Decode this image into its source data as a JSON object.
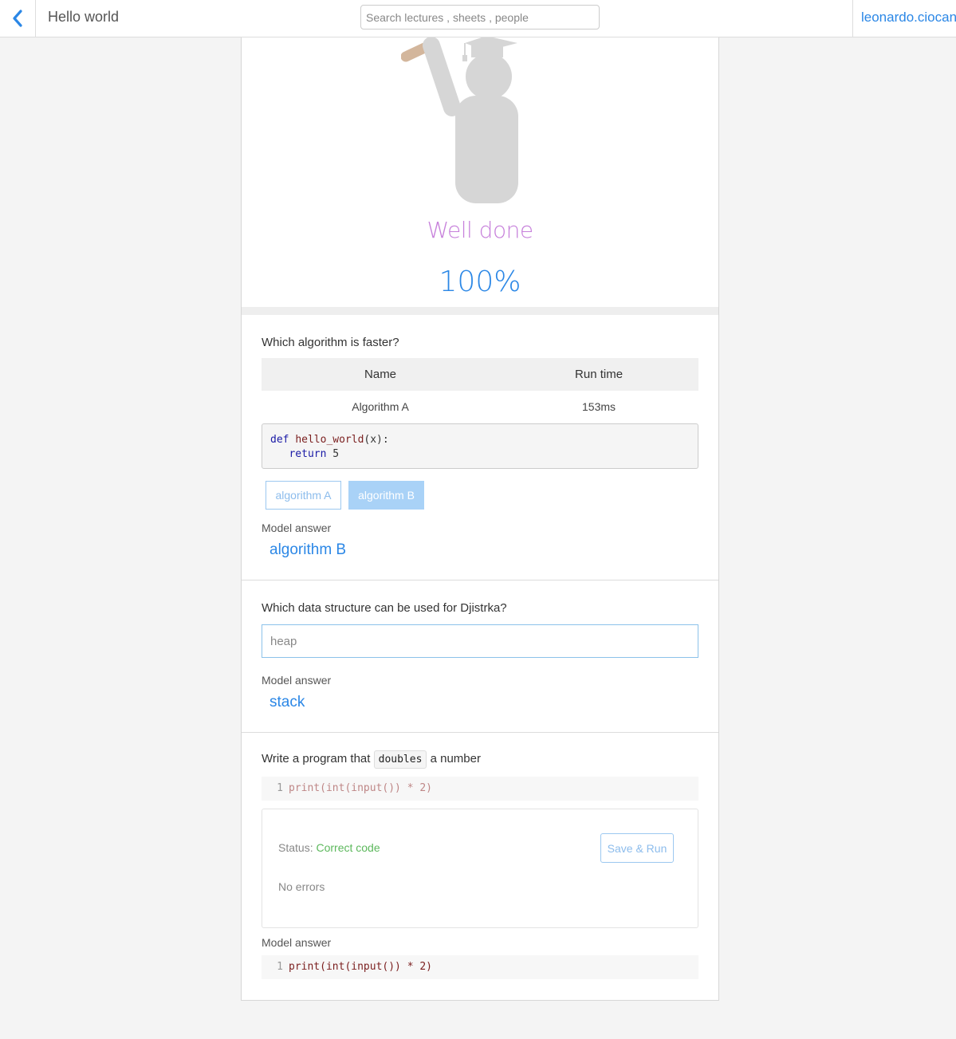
{
  "header": {
    "title": "Hello world",
    "search_placeholder": "Search lectures , sheets , people",
    "user": "leonardo.ciocan"
  },
  "result": {
    "message": "Well done",
    "score": "100%"
  },
  "question1": {
    "prompt": "Which algorithm is faster?",
    "table": {
      "headers": [
        "Name",
        "Run time"
      ],
      "rows": [
        [
          "Algorithm A",
          "153ms"
        ]
      ]
    },
    "code": {
      "line1_kw": "def",
      "line1_fn": "hello_world",
      "line1_rest": "(x):",
      "line2_kw": "return",
      "line2_rest": " 5"
    },
    "options": [
      "algorithm A",
      "algorithm B"
    ],
    "selected": "algorithm B",
    "model_label": "Model answer",
    "model_answer": "algorithm B"
  },
  "question2": {
    "prompt": "Which data structure can be used for Djistrka?",
    "input_value": "heap",
    "model_label": "Model answer",
    "model_answer": "stack"
  },
  "question3": {
    "prompt_before": "Write a program that",
    "prompt_code": "doubles",
    "prompt_after": "a number",
    "editor_line_number": "1",
    "editor_code": "print(int(input()) * 2)",
    "status_label": "Status:",
    "status_value": "Correct code",
    "errors_text": "No errors",
    "save_run_label": "Save & Run",
    "model_label": "Model answer",
    "model_line_number": "1",
    "model_code": "print(int(input()) * 2)"
  },
  "colors": {
    "accent": "#2b87e6",
    "well_done": "#c781db",
    "success": "#5cb85c"
  },
  "icons": {
    "back": "chevron-left-icon",
    "illustration": "graduate-illustration"
  }
}
